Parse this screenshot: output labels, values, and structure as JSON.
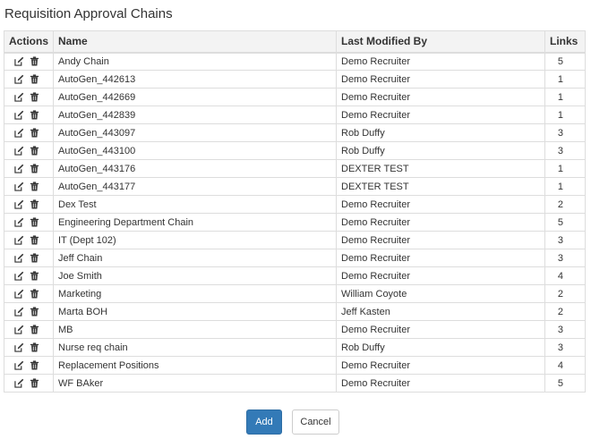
{
  "page": {
    "title": "Requisition Approval Chains"
  },
  "table": {
    "headers": {
      "actions": "Actions",
      "name": "Name",
      "modified_by": "Last Modified By",
      "links": "Links"
    },
    "rows": [
      {
        "name": "Andy Chain",
        "modified_by": "Demo Recruiter",
        "links": "5"
      },
      {
        "name": "AutoGen_442613",
        "modified_by": "Demo Recruiter",
        "links": "1"
      },
      {
        "name": "AutoGen_442669",
        "modified_by": "Demo Recruiter",
        "links": "1"
      },
      {
        "name": "AutoGen_442839",
        "modified_by": "Demo Recruiter",
        "links": "1"
      },
      {
        "name": "AutoGen_443097",
        "modified_by": "Rob Duffy",
        "links": "3"
      },
      {
        "name": "AutoGen_443100",
        "modified_by": "Rob Duffy",
        "links": "3"
      },
      {
        "name": "AutoGen_443176",
        "modified_by": "DEXTER TEST",
        "links": "1"
      },
      {
        "name": "AutoGen_443177",
        "modified_by": "DEXTER TEST",
        "links": "1"
      },
      {
        "name": "Dex Test",
        "modified_by": "Demo Recruiter",
        "links": "2"
      },
      {
        "name": "Engineering Department Chain",
        "modified_by": "Demo Recruiter",
        "links": "5"
      },
      {
        "name": "IT (Dept 102)",
        "modified_by": "Demo Recruiter",
        "links": "3"
      },
      {
        "name": "Jeff Chain",
        "modified_by": "Demo Recruiter",
        "links": "3"
      },
      {
        "name": "Joe Smith",
        "modified_by": "Demo Recruiter",
        "links": "4"
      },
      {
        "name": "Marketing",
        "modified_by": "William Coyote",
        "links": "2"
      },
      {
        "name": "Marta BOH",
        "modified_by": "Jeff Kasten",
        "links": "2"
      },
      {
        "name": "MB",
        "modified_by": "Demo Recruiter",
        "links": "3"
      },
      {
        "name": "Nurse req chain",
        "modified_by": "Rob Duffy",
        "links": "3"
      },
      {
        "name": "Replacement Positions",
        "modified_by": "Demo Recruiter",
        "links": "4"
      },
      {
        "name": "WF BAker",
        "modified_by": "Demo Recruiter",
        "links": "5"
      }
    ],
    "row_icons": [
      "edit-icon",
      "trash-icon"
    ]
  },
  "buttons": {
    "add": "Add",
    "cancel": "Cancel"
  },
  "colors": {
    "primary": "#337ab7",
    "header_bg": "#f3f3f3",
    "border": "#dddddd",
    "text": "#333333"
  }
}
